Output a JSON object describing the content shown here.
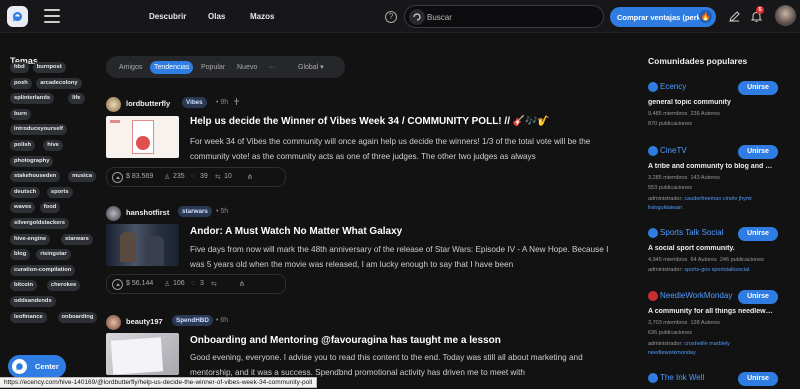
{
  "header": {
    "nav": [
      "Descubrir",
      "Olas",
      "Mazos"
    ],
    "search_placeholder": "Buscar",
    "buy_label": "Comprar ventajas (perks)",
    "notification_count": "5"
  },
  "sidebar": {
    "title": "Temas",
    "tags": [
      "hbd",
      "burnpost",
      "posh",
      "arcadecolony",
      "splinterlands",
      "life",
      "burn",
      "introduceyourself",
      "polish",
      "hive",
      "photography",
      "stakehouseden",
      "musica",
      "deutsch",
      "sports",
      "waves",
      "food",
      "silvergoldstackers",
      "hive-engine",
      "starwars",
      "blog",
      "risingstar",
      "curation-compilation",
      "bitcoin",
      "cherokee",
      "oddsandends",
      "leofinance",
      "onboarding"
    ],
    "center_label": "Center"
  },
  "feed": {
    "tabs": [
      "Amigos",
      "Tendencias",
      "Popular",
      "Nuevo",
      "···"
    ],
    "active_tab": "Tendencias",
    "filter": "Global",
    "posts": [
      {
        "author": "lordbutterfly",
        "community": "Vibes",
        "time": "9h",
        "title": "Help us decide the Winner of Vibes Week 34 / COMMUNITY POLL! // 🎸🎶🎷",
        "body": "For week 34 of Vibes the community will once again help us decide the winners! 1/3 of the total vote will be the community vote! as the community acts as one of three judges. The other two judges as always",
        "payout": "$ 83.569",
        "votes": "235",
        "comments": "39",
        "reblogs": "10"
      },
      {
        "author": "hanshotfirst",
        "community": "starwars",
        "time": "5h",
        "title": "Andor: A Must Watch No Matter What Galaxy",
        "body": "Five days from now will mark the 48th anniversary of the release of Star Wars: Episode IV - A New Hope. Because I was 5 years old when the movie was released, I am lucky enough to say that I have been",
        "payout": "$ 56.144",
        "votes": "106",
        "comments": "3",
        "reblogs": ""
      },
      {
        "author": "beauty197",
        "community": "SpendHBD",
        "time": "6h",
        "title": "Onboarding and Mentoring @favouragina has taught me a lesson",
        "body": "Good evening, everyone. I advise you to read this content to the end. Today was still all about marketing and mentorship, and it was a success. Spendbnd promotional activity has driven me to meet with"
      }
    ]
  },
  "communities": {
    "title": "Comunidades populares",
    "join_label": "Unirse",
    "items": [
      {
        "name": "Ecency",
        "desc": "general topic community",
        "members": "9,485 miembros",
        "authors": "236 Autores",
        "pubs": "870 publicaciones",
        "admins_label": "",
        "admins": "",
        "color": "#2f7de2"
      },
      {
        "name": "CineTV",
        "desc": "A tribe and community to blog and chat about films",
        "members": "3,285 miembros",
        "authors": "143 Autores",
        "pubs": "553 publicaciones",
        "admins_label": "administrador:",
        "admins": "cauderfreeman cinetv jhymi livinguktaiwan",
        "color": "#2f7de2"
      },
      {
        "name": "Sports Talk Social",
        "desc": "A social sport community.",
        "members": "4,945 miembros",
        "authors": "64 Autores",
        "pubs": "246 publicaciones",
        "admins_label": "administrador:",
        "admins": "sports-gov sportstalksocial",
        "color": "#2f7de2"
      },
      {
        "name": "NeedleWorkMonday",
        "desc": "A community for all things needlework including",
        "members": "3,703 miembros",
        "authors": "138 Autores",
        "pubs": "636 publicaciones",
        "admins_label": "administrador:",
        "admins": "crosheille marblely needleworkmonday",
        "color": "#c8302e"
      },
      {
        "name": "The Ink Well",
        "desc": "",
        "members": "",
        "authors": "",
        "pubs": "",
        "admins_label": "",
        "admins": "",
        "color": "#2f7de2"
      }
    ]
  },
  "status_url": "https://ecency.com/hive-140169/@lordbutterfly/help-us-decide-the-winner-of-vibes-week-34-community-poll"
}
